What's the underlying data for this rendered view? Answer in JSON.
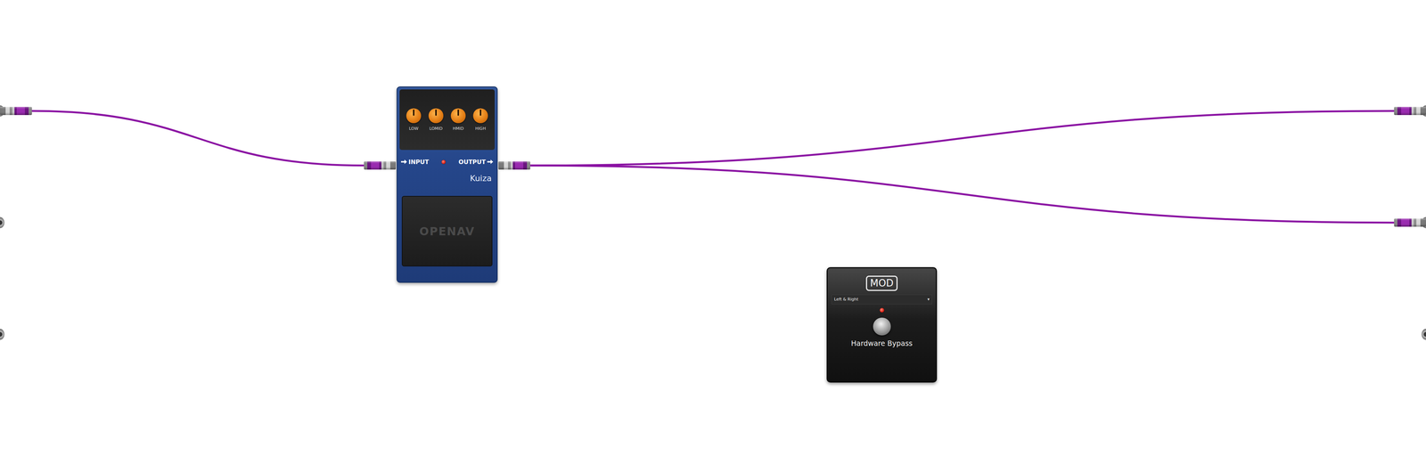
{
  "system_inputs": [
    {
      "connected": true
    },
    {
      "connected": false
    },
    {
      "connected": false
    }
  ],
  "system_outputs": [
    {
      "connected": true
    },
    {
      "connected": true
    },
    {
      "connected": false
    }
  ],
  "pedal": {
    "name": "Kuiza",
    "brand": "OPENAV",
    "input_label": "INPUT",
    "output_label": "OUTPUT",
    "led_on": true,
    "knobs": [
      {
        "label": "LOW",
        "level": 0.5
      },
      {
        "label": "LOMID",
        "level": 0.5
      },
      {
        "label": "HMID",
        "level": 0.5
      },
      {
        "label": "HIGH",
        "level": 0.5
      }
    ]
  },
  "hardware_bypass": {
    "logo": "MOD",
    "channel": "Left & Right",
    "dropdown_arrow": "▾",
    "label": "Hardware Bypass",
    "led_on": true
  }
}
